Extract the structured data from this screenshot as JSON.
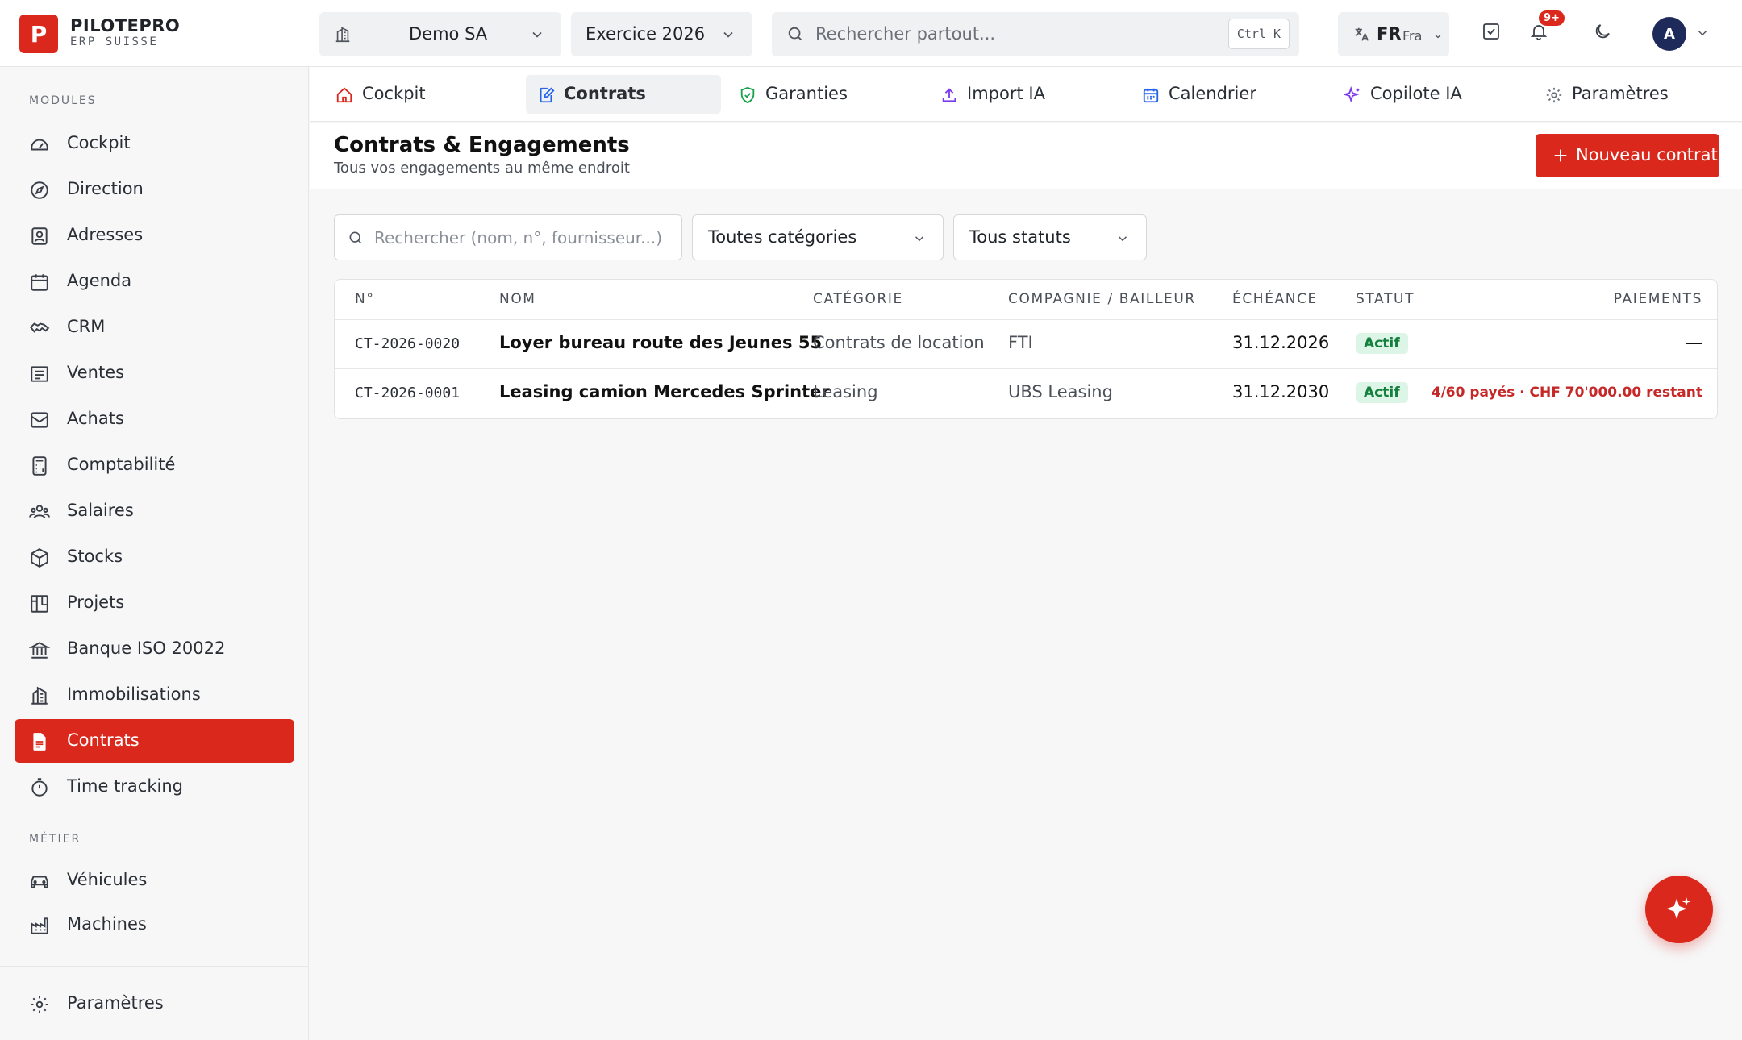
{
  "brand": {
    "logo_letter": "P",
    "name": "PILOTEPRO",
    "subtitle": "ERP SUISSE",
    "accent": "#da291c"
  },
  "topbar": {
    "company": "Demo SA",
    "fiscal_year": "Exercice 2026",
    "search_placeholder": "Rechercher partout...",
    "search_shortcut": "Ctrl K",
    "lang_code": "FR",
    "lang_name": "Fra",
    "notifications_badge": "9+",
    "avatar_initial": "A"
  },
  "sidebar": {
    "section_modules": "MODULES",
    "modules": [
      {
        "label": "Cockpit",
        "icon": "gauge-icon"
      },
      {
        "label": "Direction",
        "icon": "compass-icon"
      },
      {
        "label": "Adresses",
        "icon": "contacts-icon"
      },
      {
        "label": "Agenda",
        "icon": "calendar-icon"
      },
      {
        "label": "CRM",
        "icon": "handshake-icon"
      },
      {
        "label": "Ventes",
        "icon": "receipt-icon"
      },
      {
        "label": "Achats",
        "icon": "inbox-icon"
      },
      {
        "label": "Comptabilité",
        "icon": "calculator-icon"
      },
      {
        "label": "Salaires",
        "icon": "users-icon"
      },
      {
        "label": "Stocks",
        "icon": "box-icon"
      },
      {
        "label": "Projets",
        "icon": "kanban-icon"
      },
      {
        "label": "Banque ISO 20022",
        "icon": "bank-icon"
      },
      {
        "label": "Immobilisations",
        "icon": "building-icon"
      },
      {
        "label": "Contrats",
        "icon": "document-icon",
        "active": true
      },
      {
        "label": "Time tracking",
        "icon": "timer-icon"
      }
    ],
    "section_metier": "MÉTIER",
    "metier": [
      {
        "label": "Véhicules",
        "icon": "car-icon"
      },
      {
        "label": "Machines",
        "icon": "factory-icon"
      }
    ],
    "settings_label": "Paramètres"
  },
  "tabs": [
    {
      "label": "Cockpit",
      "icon": "home-icon",
      "color": "#da291c"
    },
    {
      "label": "Contrats",
      "icon": "edit-document-icon",
      "color": "#2563eb",
      "active": true
    },
    {
      "label": "Garanties",
      "icon": "shield-check-icon",
      "color": "#16a34a"
    },
    {
      "label": "Import IA",
      "icon": "upload-icon",
      "color": "#7c3aed"
    },
    {
      "label": "Calendrier",
      "icon": "calendar-icon",
      "color": "#2563eb"
    },
    {
      "label": "Copilote IA",
      "icon": "sparkles-icon",
      "color": "#7c3aed"
    },
    {
      "label": "Paramètres",
      "icon": "gear-icon",
      "color": "#6b7078"
    }
  ],
  "page": {
    "title": "Contrats & Engagements",
    "subtitle": "Tous vos engagements au même endroit",
    "new_button": "Nouveau contrat"
  },
  "filters": {
    "search_placeholder": "Rechercher (nom, n°, fournisseur...)",
    "category": "Toutes catégories",
    "status": "Tous statuts"
  },
  "table": {
    "headers": {
      "number": "N°",
      "name": "NOM",
      "category": "CATÉGORIE",
      "company": "COMPAGNIE / BAILLEUR",
      "due": "ÉCHÉANCE",
      "status": "STATUT",
      "payments": "PAIEMENTS"
    },
    "rows": [
      {
        "number": "CT-2026-0020",
        "name": "Loyer bureau route des Jeunes 55",
        "category": "Contrats de location",
        "company": "FTI",
        "due": "31.12.2026",
        "status": "Actif",
        "payments": "—"
      },
      {
        "number": "CT-2026-0001",
        "name": "Leasing camion Mercedes Sprinter",
        "category": "Leasing",
        "company": "UBS Leasing",
        "due": "31.12.2030",
        "status": "Actif",
        "payments": "4/60 payés · CHF 70'000.00 restant"
      }
    ]
  }
}
